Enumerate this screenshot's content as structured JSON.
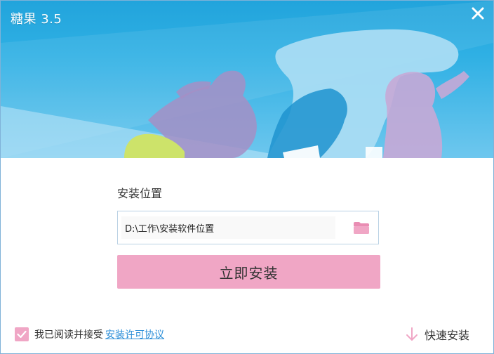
{
  "app": {
    "title": "糖果 3.5",
    "close_icon": "close-icon"
  },
  "banner": {
    "description_icon": "dancing-silhouettes-illustration"
  },
  "install": {
    "location_label": "安装位置",
    "path_value": "D:\\工作\\安装软件位置",
    "folder_icon": "folder-icon",
    "install_button_label": "立即安装"
  },
  "footer": {
    "agree_checked": true,
    "agree_text": "我已阅读并接受",
    "license_link": "安装许可协议",
    "quick_install_label": "快速安装",
    "quick_install_icon": "down-arrow-icon"
  },
  "colors": {
    "accent_pink": "#f0a6c5",
    "banner_blue": "#22a4dc",
    "link_blue": "#2d8fd8"
  }
}
